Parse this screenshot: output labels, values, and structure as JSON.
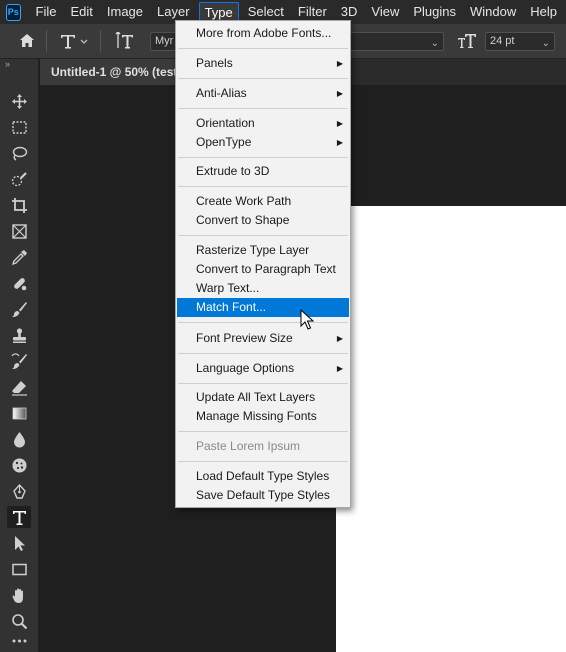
{
  "menubar": {
    "logo": "Ps",
    "items": [
      "File",
      "Edit",
      "Image",
      "Layer",
      "Type",
      "Select",
      "Filter",
      "3D",
      "View",
      "Plugins",
      "Window",
      "Help"
    ],
    "active": "Type"
  },
  "options_bar": {
    "font_family_value": "Myr",
    "font_size_value": "24 pt",
    "icons": [
      "home-icon",
      "type-tool-icon",
      "toggle-text-orientation-icon",
      "font-size-icon"
    ]
  },
  "document": {
    "tab_title": "Untitled-1 @ 50% (test,"
  },
  "tools": [
    "move",
    "marquee",
    "lasso",
    "quick-selection",
    "crop",
    "frame",
    "eyedropper",
    "spot-healing",
    "brush",
    "clone-stamp",
    "history-brush",
    "eraser",
    "gradient",
    "blur",
    "sponge",
    "pen",
    "type",
    "path-selection",
    "rectangle",
    "hand",
    "zoom",
    "more"
  ],
  "selected_tool": "type",
  "type_menu": {
    "items": [
      {
        "label": "More from Adobe Fonts...",
        "submenu": false,
        "state": "normal"
      },
      {
        "label": "Panels",
        "submenu": true,
        "state": "normal"
      },
      {
        "label": "Anti-Alias",
        "submenu": true,
        "state": "normal"
      },
      {
        "label": "Orientation",
        "submenu": true,
        "state": "normal"
      },
      {
        "label": "OpenType",
        "submenu": true,
        "state": "normal"
      },
      {
        "label": "Extrude to 3D",
        "submenu": false,
        "state": "normal"
      },
      {
        "label": "Create Work Path",
        "submenu": false,
        "state": "normal"
      },
      {
        "label": "Convert to Shape",
        "submenu": false,
        "state": "normal"
      },
      {
        "label": "Rasterize Type Layer",
        "submenu": false,
        "state": "normal"
      },
      {
        "label": "Convert to Paragraph Text",
        "submenu": false,
        "state": "normal"
      },
      {
        "label": "Warp Text...",
        "submenu": false,
        "state": "normal"
      },
      {
        "label": "Match Font...",
        "submenu": false,
        "state": "highlighted"
      },
      {
        "label": "Font Preview Size",
        "submenu": true,
        "state": "normal"
      },
      {
        "label": "Language Options",
        "submenu": true,
        "state": "normal"
      },
      {
        "label": "Update All Text Layers",
        "submenu": false,
        "state": "normal"
      },
      {
        "label": "Manage Missing Fonts",
        "submenu": false,
        "state": "normal"
      },
      {
        "label": "Paste Lorem Ipsum",
        "submenu": false,
        "state": "disabled"
      },
      {
        "label": "Load Default Type Styles",
        "submenu": false,
        "state": "normal"
      },
      {
        "label": "Save Default Type Styles",
        "submenu": false,
        "state": "normal"
      }
    ]
  }
}
